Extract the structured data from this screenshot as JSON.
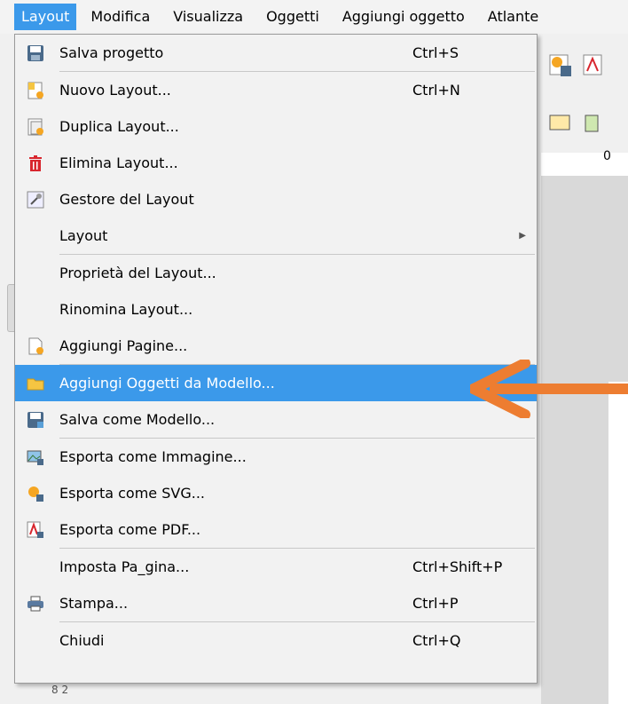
{
  "menubar": {
    "items": [
      "Layout",
      "Modifica",
      "Visualizza",
      "Oggetti",
      "Aggiungi oggetto",
      "Atlante"
    ]
  },
  "menu": {
    "items": [
      {
        "label": "Salva progetto",
        "shortcut": "Ctrl+S",
        "icon": "save-icon"
      },
      {
        "label": "Nuovo Layout...",
        "shortcut": "Ctrl+N",
        "icon": "new-layout-icon"
      },
      {
        "label": "Duplica Layout...",
        "shortcut": "",
        "icon": "duplicate-layout-icon"
      },
      {
        "label": "Elimina Layout...",
        "shortcut": "",
        "icon": "trash-icon"
      },
      {
        "label": "Gestore del Layout",
        "shortcut": "",
        "icon": "layout-manager-icon"
      },
      {
        "label": "Layout",
        "shortcut": "",
        "icon": ""
      },
      {
        "label": "Proprietà del Layout...",
        "shortcut": "",
        "icon": ""
      },
      {
        "label": "Rinomina Layout...",
        "shortcut": "",
        "icon": ""
      },
      {
        "label": "Aggiungi Pagine...",
        "shortcut": "",
        "icon": "add-pages-icon"
      },
      {
        "label": "Aggiungi Oggetti da Modello...",
        "shortcut": "",
        "icon": "folder-icon"
      },
      {
        "label": "Salva come Modello...",
        "shortcut": "",
        "icon": "save-template-icon"
      },
      {
        "label": "Esporta come Immagine...",
        "shortcut": "",
        "icon": "export-image-icon"
      },
      {
        "label": "Esporta come SVG...",
        "shortcut": "",
        "icon": "export-svg-icon"
      },
      {
        "label": "Esporta come PDF...",
        "shortcut": "",
        "icon": "export-pdf-icon"
      },
      {
        "label": "Imposta Pa_gina...",
        "shortcut": "Ctrl+Shift+P",
        "icon": ""
      },
      {
        "label": "Stampa...",
        "shortcut": "Ctrl+P",
        "icon": "printer-icon"
      },
      {
        "label": "Chiudi",
        "shortcut": "Ctrl+Q",
        "icon": ""
      }
    ]
  },
  "ruler": {
    "label": "0"
  },
  "colors": {
    "highlight": "#3b99ea",
    "arrow": "#ed7d31"
  }
}
